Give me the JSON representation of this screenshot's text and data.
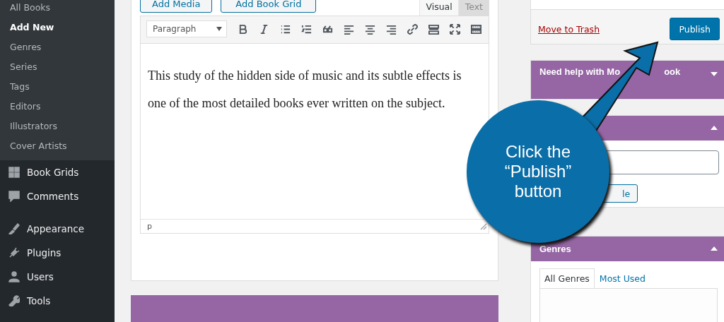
{
  "sidebar": {
    "submenu": [
      {
        "label": "All Books",
        "selected": false
      },
      {
        "label": "Add New",
        "selected": true
      },
      {
        "label": "Genres",
        "selected": false
      },
      {
        "label": "Series",
        "selected": false
      },
      {
        "label": "Tags",
        "selected": false
      },
      {
        "label": "Editors",
        "selected": false
      },
      {
        "label": "Illustrators",
        "selected": false
      },
      {
        "label": "Cover Artists",
        "selected": false
      }
    ],
    "menu": [
      {
        "label": "Book Grids"
      },
      {
        "label": "Comments"
      },
      {
        "label": "Appearance"
      },
      {
        "label": "Plugins"
      },
      {
        "label": "Users"
      },
      {
        "label": "Tools"
      }
    ]
  },
  "editor": {
    "media_buttons": [
      "Add Media",
      "Add Book Grid"
    ],
    "tabs": [
      {
        "label": "Visual",
        "selected": true
      },
      {
        "label": "Text",
        "selected": false
      }
    ],
    "format_select": "Paragraph",
    "content": "This study of the hidden side of music and its subtle effects is one of the most detailed books ever written on the subject.",
    "path": "p"
  },
  "publish": {
    "trash_link": "Move to Trash",
    "button": "Publish"
  },
  "help_box": {
    "title_parts": [
      "Need help with Mo",
      "ook"
    ],
    "expanded": false
  },
  "tags_box": {
    "expanded": true,
    "button": "le"
  },
  "genres_box": {
    "title": "Genres",
    "expanded": true,
    "tabs": [
      {
        "label": "All Genres",
        "selected": true
      },
      {
        "label": "Most Used",
        "selected": false
      }
    ]
  },
  "callout": {
    "lines": [
      "Click the",
      "“Publish”",
      "button"
    ]
  }
}
